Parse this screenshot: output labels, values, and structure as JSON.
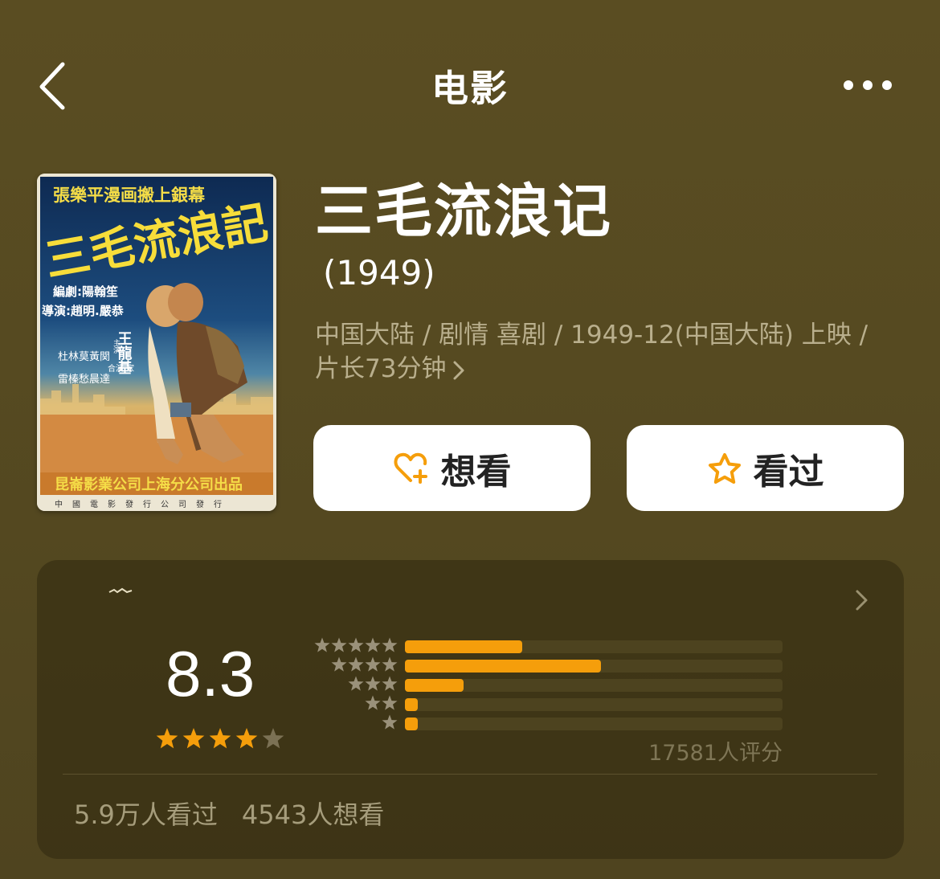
{
  "nav": {
    "title": "电影",
    "back_icon": "chevron-left-icon",
    "more_icon": "more-dots-icon"
  },
  "poster": {
    "top_banner": "張樂平漫画搬上銀幕",
    "title_art": "三毛流浪記",
    "credits_line1": "編劇:陽翰笙",
    "credits_line2": "導演:趙明.嚴恭",
    "lead_actor": "王龍基",
    "lead_label": "主演",
    "cast_col1": "杜林莫黃関",
    "cast_col2": "雷榛愁晨達",
    "cast_mid": "合演 家",
    "studio_line": "昆崙影業公司上海分公司出品",
    "distributor_line": "中國電影發行公司發行"
  },
  "movie": {
    "title": "三毛流浪记",
    "year": "(1949)",
    "meta_line1": "中国大陆 / 剧情 喜剧 / 1949-12(中国大陆) 上映 /",
    "meta_line2": "片长73分钟"
  },
  "actions": {
    "want_label": "想看",
    "want_icon": "heart-plus-icon",
    "seen_label": "看过",
    "seen_icon": "star-outline-icon",
    "accent_color": "#f59e0b"
  },
  "rating": {
    "score": "8.3",
    "stars": 4.15,
    "distribution": [
      {
        "stars": 5,
        "fraction": 0.31
      },
      {
        "stars": 4,
        "fraction": 0.52
      },
      {
        "stars": 3,
        "fraction": 0.155
      },
      {
        "stars": 2,
        "fraction": 0.035
      },
      {
        "stars": 1,
        "fraction": 0.035
      }
    ],
    "count_text": "17581人评分",
    "seen_count": "5.9万人看过",
    "want_count": "4543人想看"
  }
}
